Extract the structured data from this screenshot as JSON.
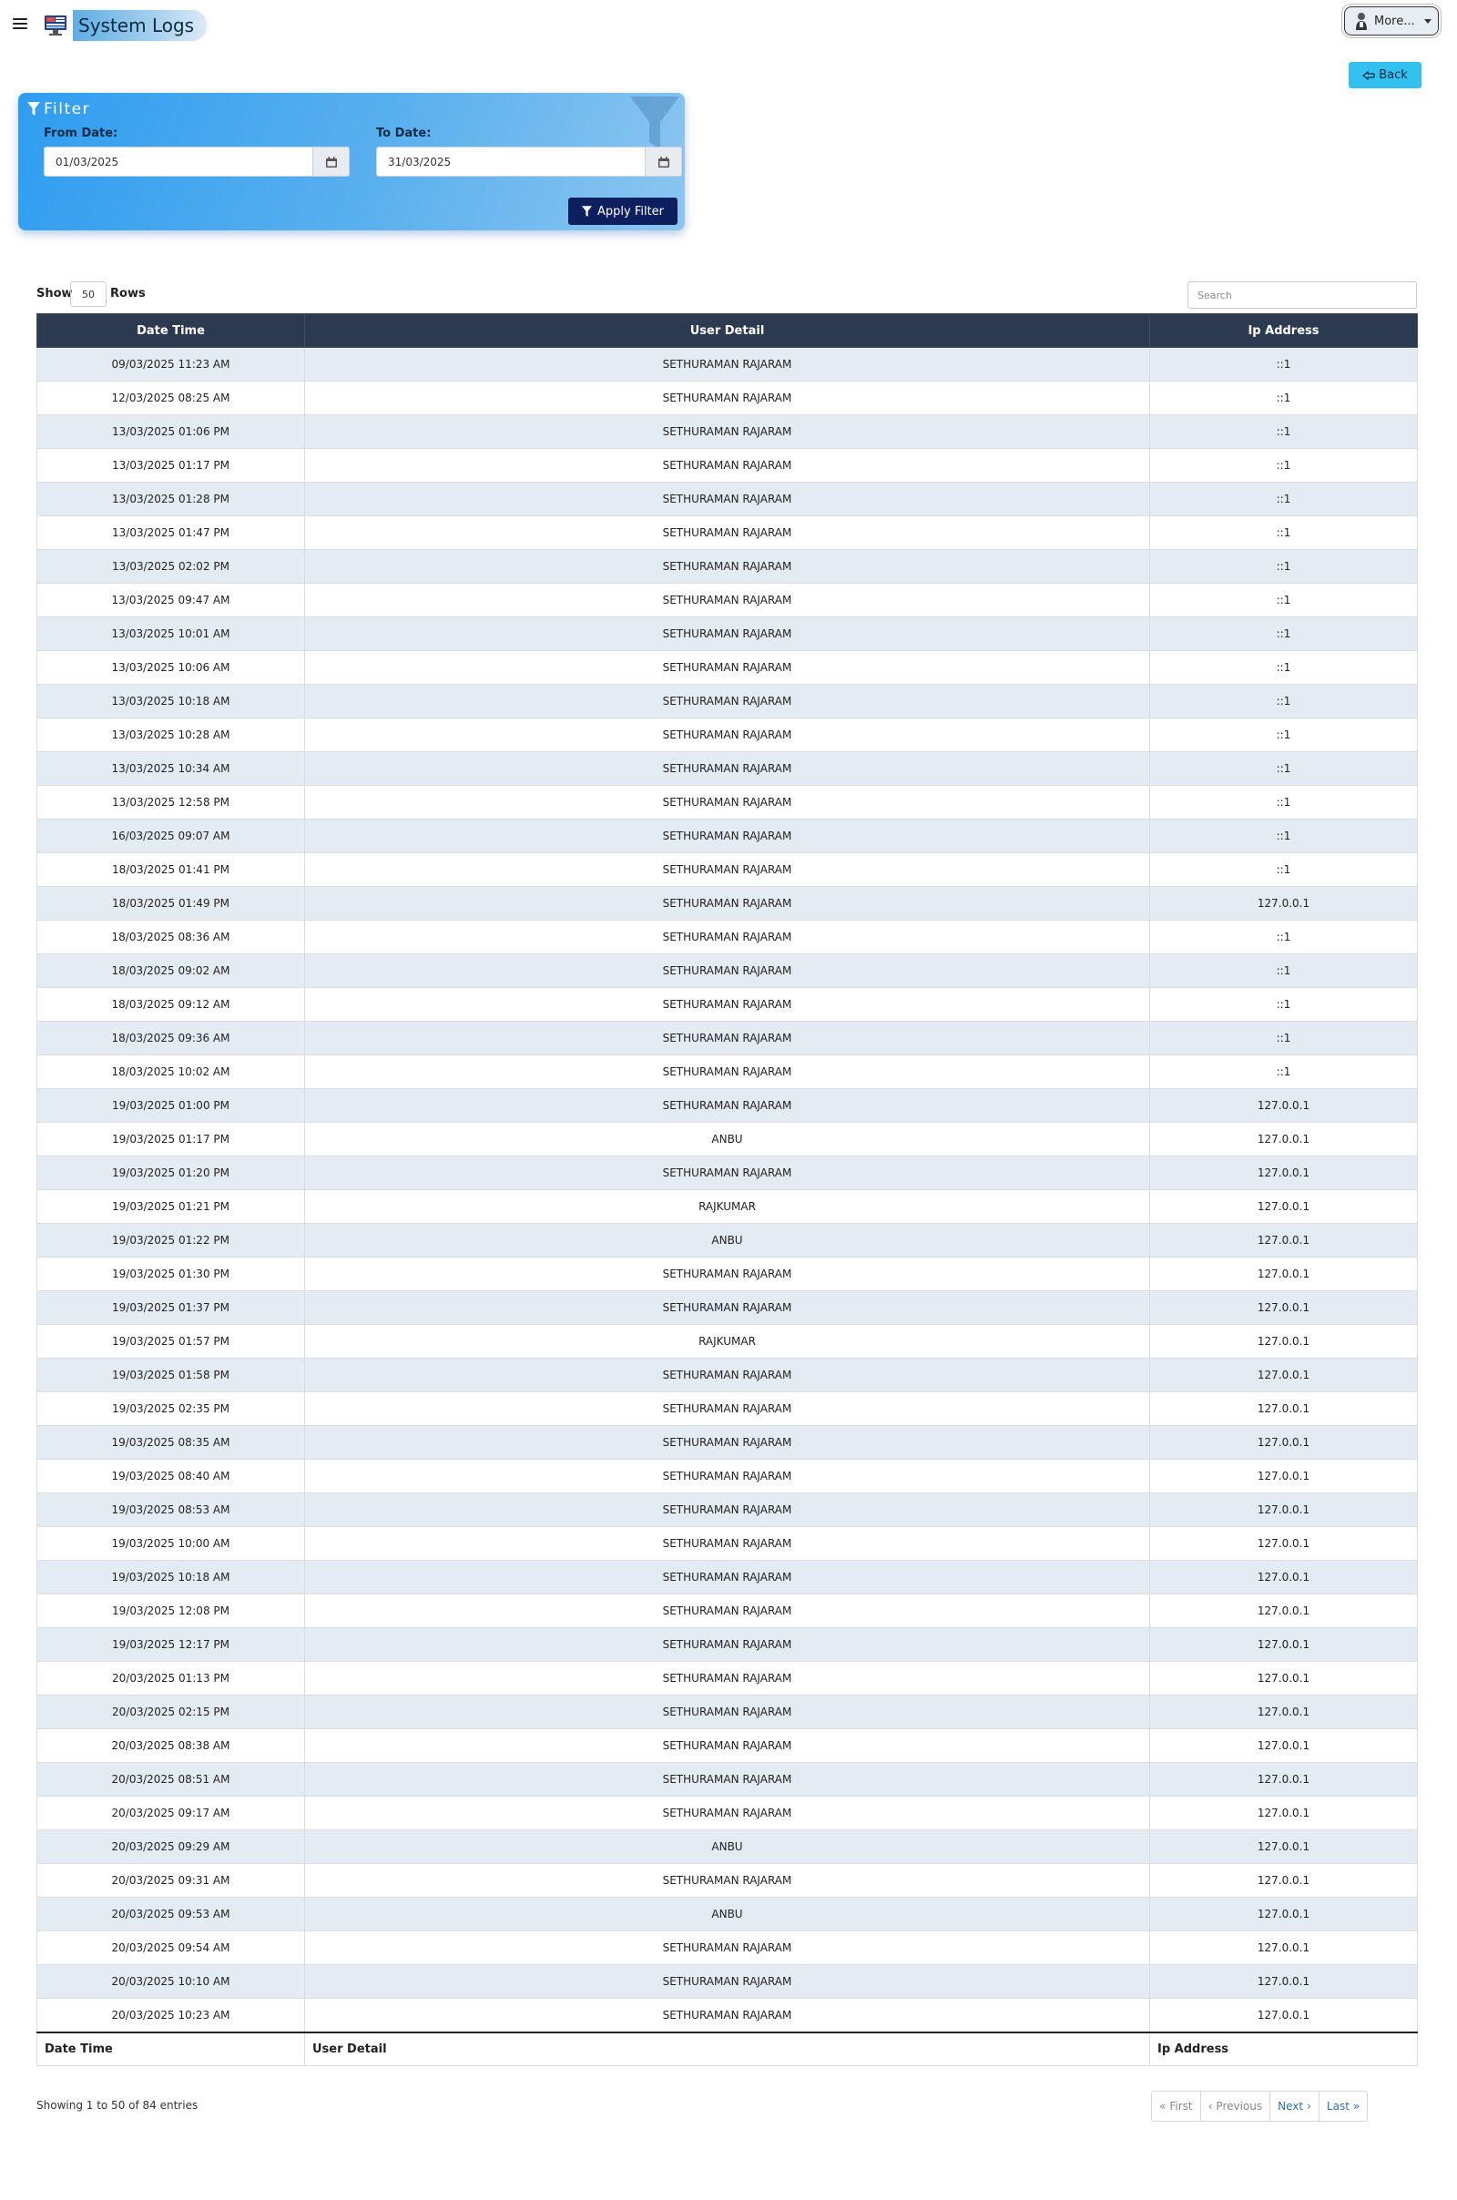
{
  "header": {
    "title": "System Logs",
    "more_label": "More..."
  },
  "back_label": "Back",
  "filter": {
    "title": "Filter",
    "from_label": "From Date:",
    "from_value": "01/03/2025",
    "to_label": "To Date:",
    "to_value": "31/03/2025",
    "apply_label": "Apply Filter"
  },
  "table_controls": {
    "show_label": "Show",
    "rows_value": "50",
    "rows_label": "Rows",
    "search_placeholder": "Search"
  },
  "table": {
    "columns": [
      "Date Time",
      "User Detail",
      "Ip Address"
    ],
    "rows": [
      [
        "09/03/2025 11:23 AM",
        "SETHURAMAN RAJARAM",
        "::1"
      ],
      [
        "12/03/2025 08:25 AM",
        "SETHURAMAN RAJARAM",
        "::1"
      ],
      [
        "13/03/2025 01:06 PM",
        "SETHURAMAN RAJARAM",
        "::1"
      ],
      [
        "13/03/2025 01:17 PM",
        "SETHURAMAN RAJARAM",
        "::1"
      ],
      [
        "13/03/2025 01:28 PM",
        "SETHURAMAN RAJARAM",
        "::1"
      ],
      [
        "13/03/2025 01:47 PM",
        "SETHURAMAN RAJARAM",
        "::1"
      ],
      [
        "13/03/2025 02:02 PM",
        "SETHURAMAN RAJARAM",
        "::1"
      ],
      [
        "13/03/2025 09:47 AM",
        "SETHURAMAN RAJARAM",
        "::1"
      ],
      [
        "13/03/2025 10:01 AM",
        "SETHURAMAN RAJARAM",
        "::1"
      ],
      [
        "13/03/2025 10:06 AM",
        "SETHURAMAN RAJARAM",
        "::1"
      ],
      [
        "13/03/2025 10:18 AM",
        "SETHURAMAN RAJARAM",
        "::1"
      ],
      [
        "13/03/2025 10:28 AM",
        "SETHURAMAN RAJARAM",
        "::1"
      ],
      [
        "13/03/2025 10:34 AM",
        "SETHURAMAN RAJARAM",
        "::1"
      ],
      [
        "13/03/2025 12:58 PM",
        "SETHURAMAN RAJARAM",
        "::1"
      ],
      [
        "16/03/2025 09:07 AM",
        "SETHURAMAN RAJARAM",
        "::1"
      ],
      [
        "18/03/2025 01:41 PM",
        "SETHURAMAN RAJARAM",
        "::1"
      ],
      [
        "18/03/2025 01:49 PM",
        "SETHURAMAN RAJARAM",
        "127.0.0.1"
      ],
      [
        "18/03/2025 08:36 AM",
        "SETHURAMAN RAJARAM",
        "::1"
      ],
      [
        "18/03/2025 09:02 AM",
        "SETHURAMAN RAJARAM",
        "::1"
      ],
      [
        "18/03/2025 09:12 AM",
        "SETHURAMAN RAJARAM",
        "::1"
      ],
      [
        "18/03/2025 09:36 AM",
        "SETHURAMAN RAJARAM",
        "::1"
      ],
      [
        "18/03/2025 10:02 AM",
        "SETHURAMAN RAJARAM",
        "::1"
      ],
      [
        "19/03/2025 01:00 PM",
        "SETHURAMAN RAJARAM",
        "127.0.0.1"
      ],
      [
        "19/03/2025 01:17 PM",
        "ANBU",
        "127.0.0.1"
      ],
      [
        "19/03/2025 01:20 PM",
        "SETHURAMAN RAJARAM",
        "127.0.0.1"
      ],
      [
        "19/03/2025 01:21 PM",
        "RAJKUMAR",
        "127.0.0.1"
      ],
      [
        "19/03/2025 01:22 PM",
        "ANBU",
        "127.0.0.1"
      ],
      [
        "19/03/2025 01:30 PM",
        "SETHURAMAN RAJARAM",
        "127.0.0.1"
      ],
      [
        "19/03/2025 01:37 PM",
        "SETHURAMAN RAJARAM",
        "127.0.0.1"
      ],
      [
        "19/03/2025 01:57 PM",
        "RAJKUMAR",
        "127.0.0.1"
      ],
      [
        "19/03/2025 01:58 PM",
        "SETHURAMAN RAJARAM",
        "127.0.0.1"
      ],
      [
        "19/03/2025 02:35 PM",
        "SETHURAMAN RAJARAM",
        "127.0.0.1"
      ],
      [
        "19/03/2025 08:35 AM",
        "SETHURAMAN RAJARAM",
        "127.0.0.1"
      ],
      [
        "19/03/2025 08:40 AM",
        "SETHURAMAN RAJARAM",
        "127.0.0.1"
      ],
      [
        "19/03/2025 08:53 AM",
        "SETHURAMAN RAJARAM",
        "127.0.0.1"
      ],
      [
        "19/03/2025 10:00 AM",
        "SETHURAMAN RAJARAM",
        "127.0.0.1"
      ],
      [
        "19/03/2025 10:18 AM",
        "SETHURAMAN RAJARAM",
        "127.0.0.1"
      ],
      [
        "19/03/2025 12:08 PM",
        "SETHURAMAN RAJARAM",
        "127.0.0.1"
      ],
      [
        "19/03/2025 12:17 PM",
        "SETHURAMAN RAJARAM",
        "127.0.0.1"
      ],
      [
        "20/03/2025 01:13 PM",
        "SETHURAMAN RAJARAM",
        "127.0.0.1"
      ],
      [
        "20/03/2025 02:15 PM",
        "SETHURAMAN RAJARAM",
        "127.0.0.1"
      ],
      [
        "20/03/2025 08:38 AM",
        "SETHURAMAN RAJARAM",
        "127.0.0.1"
      ],
      [
        "20/03/2025 08:51 AM",
        "SETHURAMAN RAJARAM",
        "127.0.0.1"
      ],
      [
        "20/03/2025 09:17 AM",
        "SETHURAMAN RAJARAM",
        "127.0.0.1"
      ],
      [
        "20/03/2025 09:29 AM",
        "ANBU",
        "127.0.0.1"
      ],
      [
        "20/03/2025 09:31 AM",
        "SETHURAMAN RAJARAM",
        "127.0.0.1"
      ],
      [
        "20/03/2025 09:53 AM",
        "ANBU",
        "127.0.0.1"
      ],
      [
        "20/03/2025 09:54 AM",
        "SETHURAMAN RAJARAM",
        "127.0.0.1"
      ],
      [
        "20/03/2025 10:10 AM",
        "SETHURAMAN RAJARAM",
        "127.0.0.1"
      ],
      [
        "20/03/2025 10:23 AM",
        "SETHURAMAN RAJARAM",
        "127.0.0.1"
      ]
    ],
    "footer": [
      "Date Time",
      "User Detail",
      "Ip Address"
    ]
  },
  "pagination": {
    "info": "Showing 1 to 50 of 84 entries",
    "first": "First",
    "previous": "Previous",
    "next": "Next",
    "last": "Last"
  },
  "colors": {
    "header_bg": "#2b3a4e",
    "row_stripe": "#e3ebf3",
    "filter_blue": "#2f9df0",
    "apply_btn": "#0d1f5e",
    "back_btn": "#33c2f0"
  },
  "icons": [
    "menu-icon",
    "monitor-logo-icon",
    "user-avatar-icon",
    "back-hand-icon",
    "filter-icon",
    "calendar-icon",
    "double-chevron-left-icon",
    "chevron-left-icon",
    "chevron-right-icon",
    "double-chevron-right-icon"
  ]
}
